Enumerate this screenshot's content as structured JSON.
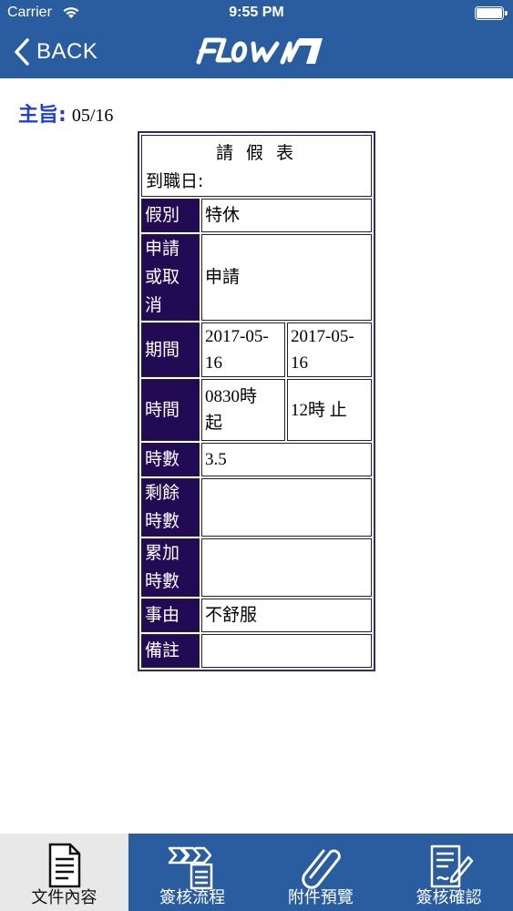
{
  "status_bar": {
    "carrier": "Carrier",
    "time": "9:55 PM"
  },
  "nav": {
    "back_label": "BACK",
    "logo_text": "Flow"
  },
  "subject": {
    "label": "主旨:",
    "value": "05/16"
  },
  "form": {
    "title": "請 假 表",
    "hire_date": "到職日:",
    "rows": {
      "leave_type": {
        "label": "假別",
        "value": "特休"
      },
      "apply": {
        "label": "申請\n或取\n消",
        "value": "申請"
      },
      "period": {
        "label": "期間",
        "start": "2017-05-\n16",
        "end": "2017-05-\n16"
      },
      "time": {
        "label": "時間",
        "start": "0830時\n起",
        "end": "12時 止"
      },
      "hours": {
        "label": "時數",
        "value": "3.5"
      },
      "remaining": {
        "label": "剩餘\n時數",
        "value": ""
      },
      "accumulated": {
        "label": "累加\n時數",
        "value": ""
      },
      "reason": {
        "label": "事由",
        "value": "不舒服"
      },
      "remark": {
        "label": "備註",
        "value": ""
      }
    }
  },
  "tabs": [
    {
      "label": "文件內容",
      "icon": "document-icon",
      "active": true
    },
    {
      "label": "簽核流程",
      "icon": "flow-icon",
      "active": false
    },
    {
      "label": "附件預覽",
      "icon": "paperclip-icon",
      "active": false
    },
    {
      "label": "簽核確認",
      "icon": "sign-confirm-icon",
      "active": false
    }
  ],
  "colors": {
    "bar": "#2a5d9f",
    "label_bg": "#220a55",
    "subject": "#1f3fd6"
  }
}
